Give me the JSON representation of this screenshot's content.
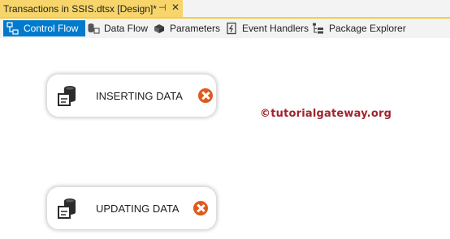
{
  "document_tab": {
    "title": "Transactions in SSIS.dtsx [Design]*",
    "pin_glyph": "⊣",
    "close_glyph": "✕"
  },
  "designer_tabs": [
    {
      "label": "Control Flow",
      "icon": "control-flow-icon",
      "active": true
    },
    {
      "label": "Data Flow",
      "icon": "data-flow-icon",
      "active": false
    },
    {
      "label": "Parameters",
      "icon": "parameters-icon",
      "active": false
    },
    {
      "label": "Event Handlers",
      "icon": "event-handlers-icon",
      "active": false
    },
    {
      "label": "Package Explorer",
      "icon": "package-explorer-icon",
      "active": false
    }
  ],
  "watermark": "©tutorialgateway.org",
  "tasks": [
    {
      "label": "INSERTING DATA",
      "icon": "execute-sql-task-icon",
      "status": "error"
    },
    {
      "label": "UPDATING DATA",
      "icon": "execute-sql-task-icon",
      "status": "error"
    }
  ],
  "colors": {
    "tab_active_bg": "#007acc",
    "doc_tab_bg": "#f7d56a",
    "error_badge": "#e05a1d",
    "watermark": "#a0242d"
  }
}
